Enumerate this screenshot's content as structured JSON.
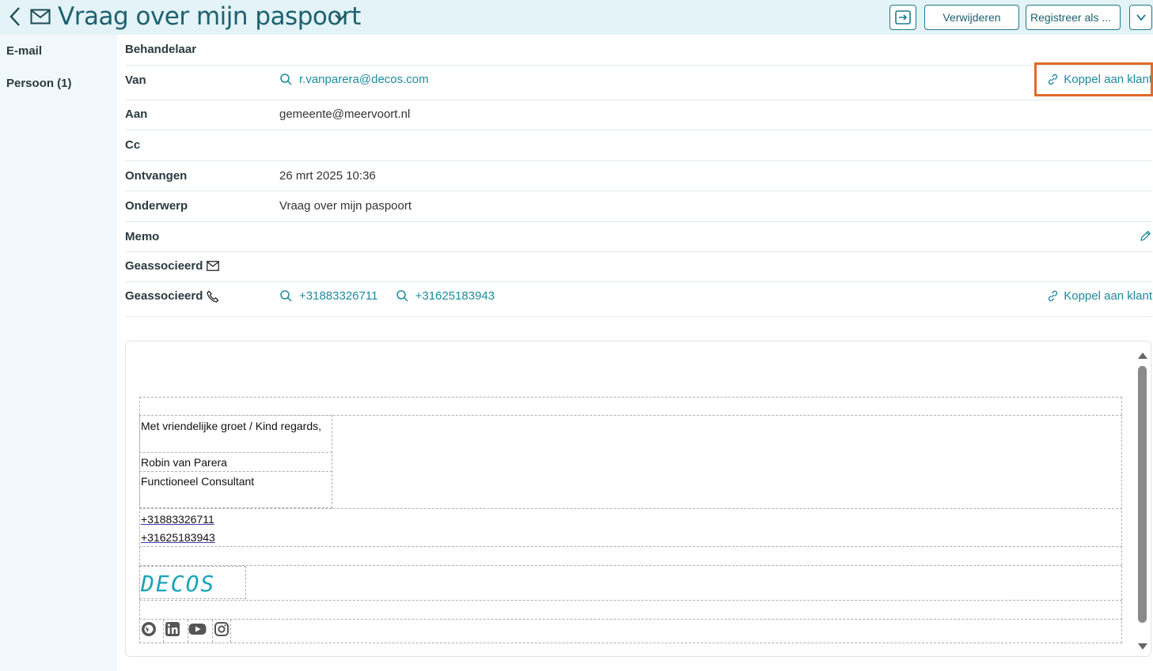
{
  "header": {
    "title": "Vraag over mijn paspoort",
    "buttons": {
      "delete": "Verwijderen",
      "register": "Registreer als ..."
    }
  },
  "sidebar": {
    "items": [
      {
        "label": "E-mail"
      },
      {
        "label": "Persoon (1)"
      }
    ]
  },
  "fields": {
    "behandelaar": {
      "label": "Behandelaar",
      "value": ""
    },
    "van": {
      "label": "Van",
      "value": "r.vanparera@decos.com",
      "action": "Koppel aan klant"
    },
    "aan": {
      "label": "Aan",
      "value": "gemeente@meervoort.nl"
    },
    "cc": {
      "label": "Cc",
      "value": ""
    },
    "ontvangen": {
      "label": "Ontvangen",
      "value": "26 mrt 2025 10:36"
    },
    "onderwerp": {
      "label": "Onderwerp",
      "value": "Vraag over mijn paspoort"
    },
    "memo": {
      "label": "Memo",
      "value": ""
    },
    "geassocieerd_mail": {
      "label": "Geassocieerd"
    },
    "geassocieerd_phone": {
      "label": "Geassocieerd",
      "phone1": "+31883326711",
      "phone2": "+31625183943",
      "action": "Koppel aan klant"
    }
  },
  "message": {
    "greeting": "Met vriendelijke groet / Kind regards,",
    "name": "Robin van Parera",
    "role": "Functioneel Consultant",
    "phone1": "+31883326711",
    "phone2": "+31625183943",
    "logo_text": "DECOS",
    "social_icons": [
      "globe-icon",
      "linkedin-icon",
      "youtube-icon",
      "instagram-icon"
    ]
  },
  "colors": {
    "accent": "#1d8a9e",
    "title": "#1d6170",
    "highlight": "#e06a2a",
    "topbar": "#e3f3f7",
    "sidebar": "#f1f8fb"
  }
}
